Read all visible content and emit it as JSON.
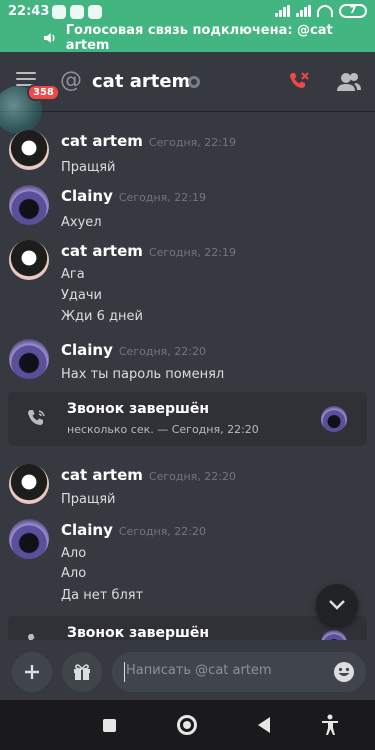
{
  "status_bar": {
    "time": "22:43",
    "battery": "7"
  },
  "voice_banner": {
    "text": "Голосовая связь подключена: @cat artem"
  },
  "header": {
    "mention_count": "358",
    "channel_name": "cat artem"
  },
  "messages": [
    {
      "author": "cat artem",
      "avatar": "cat",
      "time": "Сегодня, 22:19",
      "lines": [
        "Пращяй"
      ]
    },
    {
      "author": "Clainy",
      "avatar": "clainy",
      "time": "Сегодня, 22:19",
      "lines": [
        "Ахуел"
      ]
    },
    {
      "author": "cat artem",
      "avatar": "cat",
      "time": "Сегодня, 22:19",
      "lines": [
        "Ага",
        "Удачи",
        "Жди 6 дней"
      ]
    },
    {
      "author": "Clainy",
      "avatar": "clainy",
      "time": "Сегодня, 22:20",
      "lines": [
        "Нах ты пароль поменял"
      ]
    },
    {
      "author": "cat artem",
      "avatar": "cat",
      "time": "Сегодня, 22:20",
      "lines": [
        "Пращяй"
      ]
    },
    {
      "author": "Clainy",
      "avatar": "clainy",
      "time": "Сегодня, 22:20",
      "lines": [
        "Ало",
        "Ало",
        "Да нет блят"
      ]
    }
  ],
  "calls": [
    {
      "title": "Звонок завершён",
      "subtitle": "несколько сек. — Сегодня, 22:20"
    },
    {
      "title": "Звонок завершён"
    }
  ],
  "composer": {
    "placeholder": "Написать @cat artem"
  },
  "colors": {
    "voice_green": "#43b581",
    "background": "#36393f",
    "hangup_red": "#f04747"
  }
}
